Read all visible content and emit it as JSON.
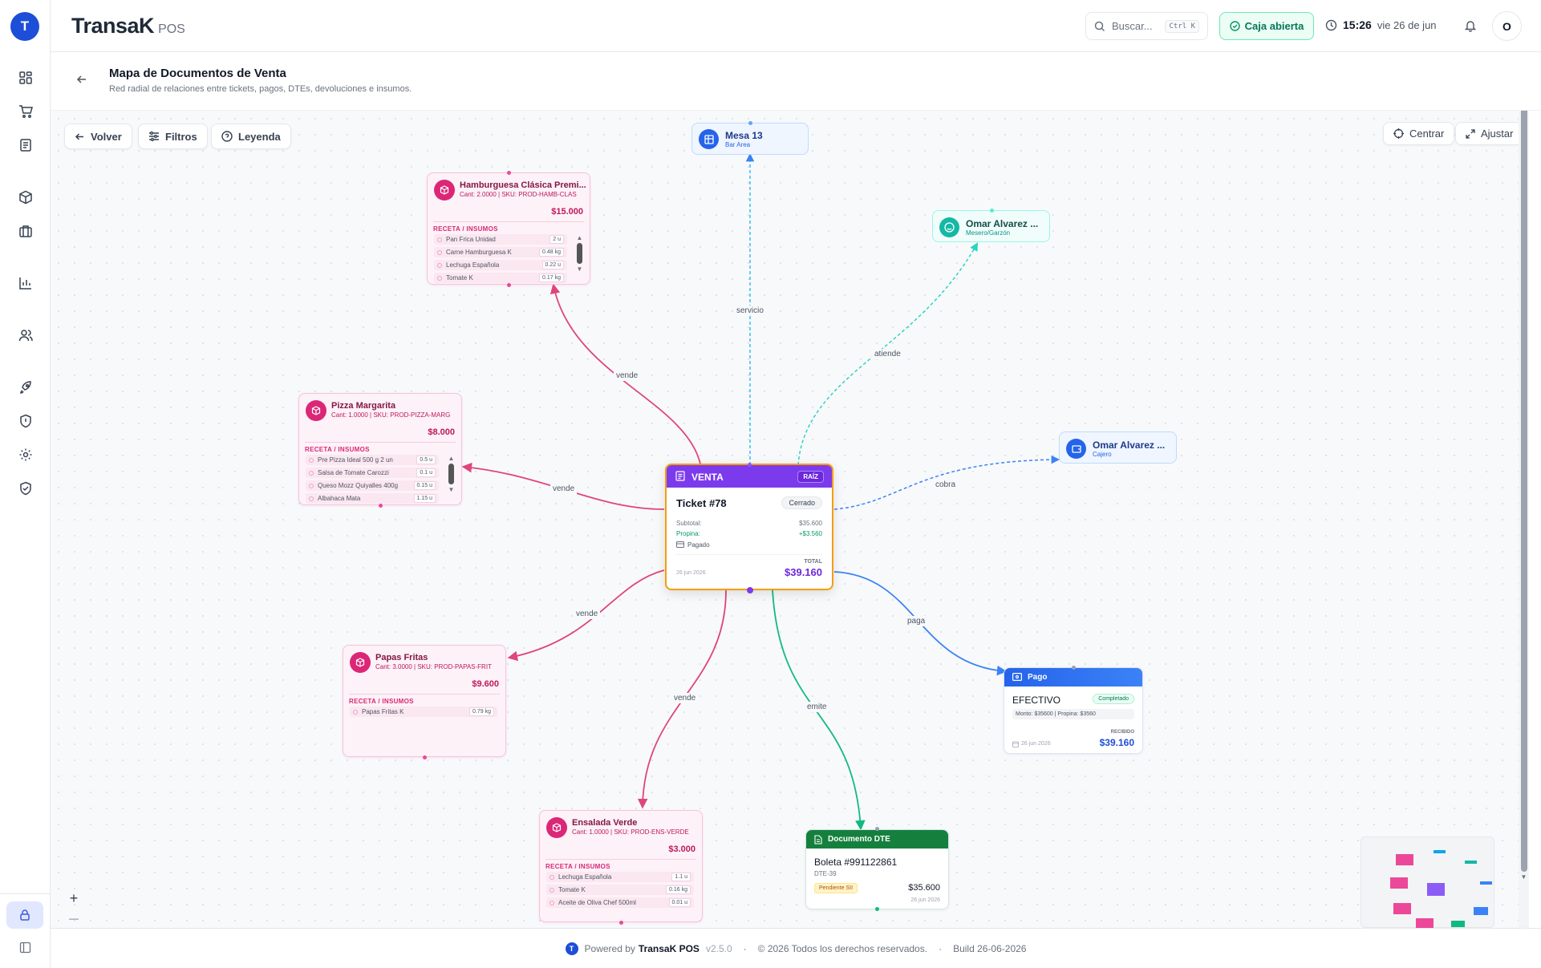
{
  "app": {
    "brand_main": "TransaK",
    "brand_sub": "POS",
    "logo_letter": "T",
    "avatar_letter": "O"
  },
  "topbar": {
    "search_placeholder": "Buscar...",
    "search_shortcut": "Ctrl K",
    "status_label": "Caja abierta",
    "time": "15:26",
    "date": "vie 26 de jun"
  },
  "sidebar": {
    "items": [
      {
        "icon": "dashboard-icon"
      },
      {
        "icon": "cart-icon"
      },
      {
        "icon": "document-icon"
      },
      {
        "icon": "box-icon"
      },
      {
        "icon": "briefcase-icon"
      },
      {
        "icon": "chart-icon"
      },
      {
        "icon": "users-icon"
      },
      {
        "icon": "rocket-icon"
      },
      {
        "icon": "shield-alert-icon"
      },
      {
        "icon": "gear-icon"
      },
      {
        "icon": "shield-check-icon"
      }
    ]
  },
  "page": {
    "title": "Mapa de Documentos de Venta",
    "subtitle": "Red radial de relaciones entre tickets, pagos, DTEs, devoluciones e insumos."
  },
  "toolbar": {
    "back": "Volver",
    "filters": "Filtros",
    "legend": "Leyenda",
    "center": "Centrar",
    "fit": "Ajustar"
  },
  "root": {
    "header": "VENTA",
    "badge": "RAÍZ",
    "ticket": "Ticket #78",
    "status": "Cerrado",
    "subtotal_label": "Subtotal:",
    "subtotal": "$35.600",
    "tip_label": "Propina:",
    "tip": "+$3.560",
    "paid": "Pagado",
    "total_label": "TOTAL",
    "date": "26 jun 2026",
    "total": "$39.160"
  },
  "mesa": {
    "name": "Mesa 13",
    "area": "Bar Area"
  },
  "waiter": {
    "name": "Omar Alvarez ...",
    "role": "Mesero/Garzón"
  },
  "cashier": {
    "name": "Omar Alvarez ...",
    "role": "Cajero"
  },
  "payment": {
    "header": "Pago",
    "method": "EFECTIVO",
    "status": "Completado",
    "detail": "Monto: $35600 | Propina: $3560",
    "received_label": "RECIBIDO",
    "date": "26 jun 2026",
    "amount": "$39.160"
  },
  "dte": {
    "header": "Documento DTE",
    "doc": "Boleta #991122861",
    "type": "DTE-39",
    "status": "Pendiente SII",
    "amount": "$35.600",
    "date": "26 jun 2026"
  },
  "recipe_label": "RECETA / INSUMOS",
  "products": {
    "hamburguesa": {
      "name": "Hamburguesa Clásica Premi...",
      "meta": "Cant: 2.0000 | SKU: PROD-HAMB-CLAS",
      "price": "$15.000",
      "ingredients": [
        {
          "name": "Pan Frica Unidad",
          "qty": "2 u"
        },
        {
          "name": "Carne Hamburguesa K",
          "qty": "0.48 kg"
        },
        {
          "name": "Lechuga Española",
          "qty": "0.22 u"
        },
        {
          "name": "Tomate K",
          "qty": "0.17 kg"
        }
      ]
    },
    "pizza": {
      "name": "Pizza Margarita",
      "meta": "Cant: 1.0000 | SKU: PROD-PIZZA-MARG",
      "price": "$8.000",
      "ingredients": [
        {
          "name": "Pre Pizza Ideal 500 g 2 un",
          "qty": "0.5 u"
        },
        {
          "name": "Salsa de Tomate Carozzi",
          "qty": "0.1 u"
        },
        {
          "name": "Queso Mozz Quiyalles 400g",
          "qty": "0.15 u"
        },
        {
          "name": "Albahaca Mata",
          "qty": "1.15 u"
        }
      ]
    },
    "papas": {
      "name": "Papas Fritas",
      "meta": "Cant: 3.0000 | SKU: PROD-PAPAS-FRIT",
      "price": "$9.600",
      "ingredients": [
        {
          "name": "Papas Fritas K",
          "qty": "0.79 kg"
        }
      ]
    },
    "ensalada": {
      "name": "Ensalada Verde",
      "meta": "Cant: 1.0000 | SKU: PROD-ENS-VERDE",
      "price": "$3.000",
      "ingredients": [
        {
          "name": "Lechuga Española",
          "qty": "1.1 u"
        },
        {
          "name": "Tomate K",
          "qty": "0.16 kg"
        },
        {
          "name": "Aceite de Oliva Chef 500ml",
          "qty": "0.01 u"
        }
      ]
    }
  },
  "edges": {
    "servicio": "servicio",
    "atiende": "atiende",
    "cobra": "cobra",
    "vende": "vende",
    "paga": "paga",
    "emite": "emite"
  },
  "zoom": {
    "in": "+",
    "out": "—"
  },
  "footer": {
    "powered": "Powered by",
    "brand": "TransaK POS",
    "version": "v2.5.0",
    "sep": "·",
    "copyright": "© 2026 Todos los derechos reservados.",
    "build": "Build 26-06-2026"
  },
  "colors": {
    "accent": "#2563eb",
    "venta": "#7c3aed",
    "product": "#db2777",
    "dte": "#10b981",
    "waiter": "#14b8a6",
    "cash_open": "#059669",
    "root_border": "#f59e0b"
  }
}
